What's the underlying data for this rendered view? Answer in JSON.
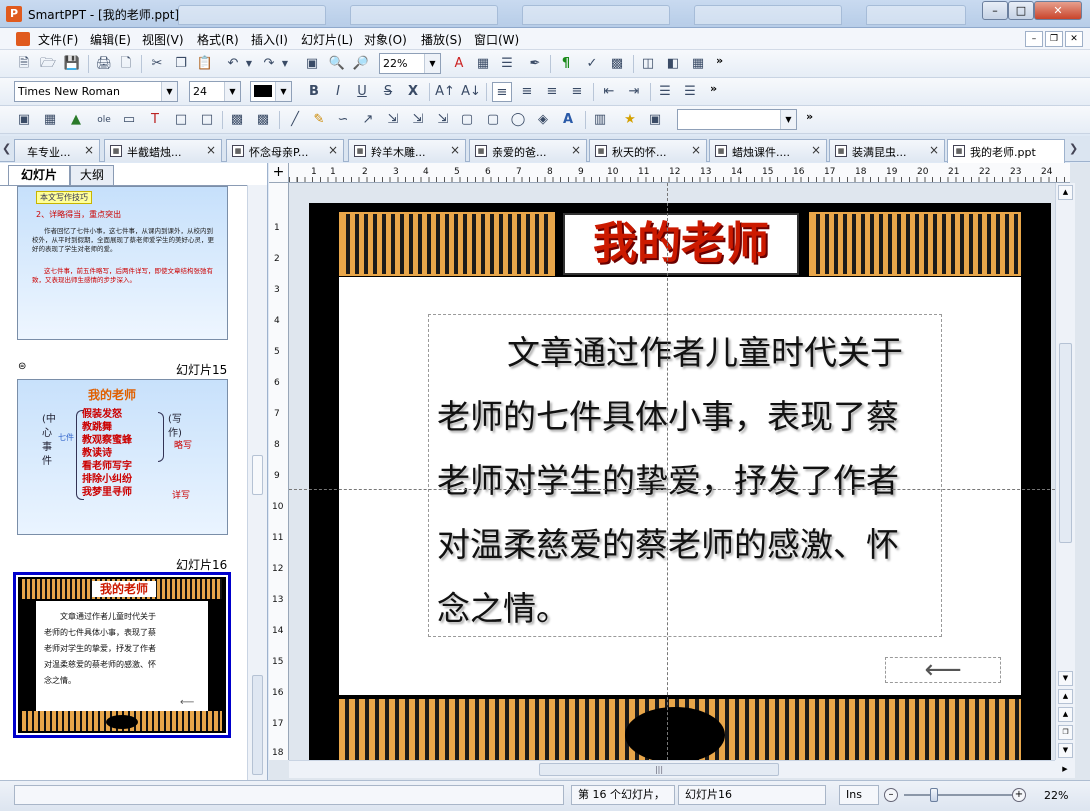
{
  "window": {
    "title": "SmartPPT - [我的老师.ppt]",
    "app_icon_letter": "P"
  },
  "menu": [
    {
      "label": "文件(F)",
      "name": "menu-file"
    },
    {
      "label": "编辑(E)",
      "name": "menu-edit"
    },
    {
      "label": "视图(V)",
      "name": "menu-view"
    },
    {
      "label": "格式(R)",
      "name": "menu-format"
    },
    {
      "label": "插入(I)",
      "name": "menu-insert"
    },
    {
      "label": "幻灯片(L)",
      "name": "menu-slide"
    },
    {
      "label": "对象(O)",
      "name": "menu-object"
    },
    {
      "label": "播放(S)",
      "name": "menu-play"
    },
    {
      "label": "窗口(W)",
      "name": "menu-window"
    }
  ],
  "toolbar": {
    "zoom": "22%",
    "font_family": "Times New Roman",
    "font_size": "24",
    "more_symbol": "»"
  },
  "doc_tabs": [
    {
      "label": "车专业..."
    },
    {
      "label": "半截蜡烛..."
    },
    {
      "label": "怀念母亲P..."
    },
    {
      "label": "羚羊木雕..."
    },
    {
      "label": "亲爱的爸..."
    },
    {
      "label": "秋天的怀..."
    },
    {
      "label": "蜡烛课件...."
    },
    {
      "label": "装满昆虫..."
    },
    {
      "label": "我的老师.ppt"
    }
  ],
  "panel_tabs": {
    "slides": "幻灯片",
    "outline": "大纲"
  },
  "thumbnails": {
    "t14": {
      "heading": "本文写作技巧",
      "point": "2、详略得当，重点突出",
      "para1": "作者回忆了七件小事，这七件事，从课内到课外，从校内到校外，从平时到假期，全面展现了蔡老师爱学生的美好心灵，更好的表现了学生对老师的爱。",
      "para2": "这七件事，前五件略写，后两件详写，即使文章结构张弛有致，又表现出师生感情的步步深入。"
    },
    "t15": {
      "label": "幻灯片15",
      "title": "我的老师",
      "left1": "(中",
      "left2": "心",
      "left3": "事",
      "left4": "件",
      "left_mid": "七件",
      "items": [
        "假装发怒",
        "教跳舞",
        "教观察蜜蜂",
        "教读诗",
        "看老师写字",
        "排除小纠纷",
        "我梦里寻师"
      ],
      "right1": "(写",
      "right2": "作)",
      "note_brief": "略写",
      "note_detail": "详写"
    },
    "t16": {
      "label": "幻灯片16",
      "title": "我的老师",
      "lines": [
        "文章通过作者儿童时代关于",
        "老师的七件具体小事，表现了蔡",
        "老师对学生的挚爱，抒发了作者",
        "对温柔慈爱的蔡老师的感激、怀",
        "念之情。"
      ]
    }
  },
  "slide": {
    "title": "我的老师",
    "lines": [
      "文章通过作者儿童时代关于",
      "老师的七件具体小事，表现了蔡",
      "老师对学生的挚爱，抒发了作者",
      "对温柔慈爱的蔡老师的感激、怀",
      "念之情。"
    ]
  },
  "ruler": {
    "h": [
      "1",
      "1",
      "2",
      "3",
      "4",
      "5",
      "6",
      "7",
      "8",
      "9",
      "10",
      "11",
      "12",
      "13",
      "14",
      "15",
      "16",
      "17",
      "18",
      "19",
      "20",
      "21",
      "22",
      "23",
      "24"
    ],
    "v": [
      "1",
      "2",
      "3",
      "4",
      "5",
      "6",
      "7",
      "8",
      "9",
      "10",
      "11",
      "12",
      "13",
      "14",
      "15",
      "16",
      "17",
      "18"
    ],
    "hscroll_grip": "|||"
  },
  "status": {
    "slide_position": "第 16 个幻灯片，",
    "slide_name": "幻灯片16",
    "ins": "Ins",
    "zoom": "22%",
    "zoom_fraction": 0.28
  },
  "colors": {
    "accent": "#0000cc",
    "slide_title_red": "#cc1a00",
    "border_orange": "#e8a64a"
  }
}
